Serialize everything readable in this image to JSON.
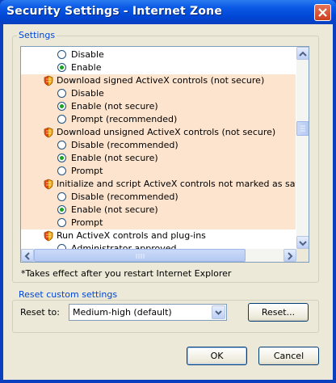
{
  "window": {
    "title": "Security Settings - Internet Zone"
  },
  "settings_group": {
    "label": "Settings"
  },
  "list": {
    "rows": [
      {
        "kind": "radio",
        "label": "Disable",
        "checked": false,
        "indent": 1,
        "hl": false
      },
      {
        "kind": "radio",
        "label": "Enable",
        "checked": true,
        "indent": 1,
        "hl": false
      },
      {
        "kind": "header",
        "label": "Download signed ActiveX controls (not secure)",
        "hl": true
      },
      {
        "kind": "radio",
        "label": "Disable",
        "checked": false,
        "indent": 1,
        "hl": true
      },
      {
        "kind": "radio",
        "label": "Enable (not secure)",
        "checked": true,
        "indent": 1,
        "hl": true
      },
      {
        "kind": "radio",
        "label": "Prompt (recommended)",
        "checked": false,
        "indent": 1,
        "hl": true
      },
      {
        "kind": "header",
        "label": "Download unsigned ActiveX controls (not secure)",
        "hl": true
      },
      {
        "kind": "radio",
        "label": "Disable (recommended)",
        "checked": false,
        "indent": 1,
        "hl": true
      },
      {
        "kind": "radio",
        "label": "Enable (not secure)",
        "checked": true,
        "indent": 1,
        "hl": true
      },
      {
        "kind": "radio",
        "label": "Prompt",
        "checked": false,
        "indent": 1,
        "hl": true
      },
      {
        "kind": "header",
        "label": "Initialize and script ActiveX controls not marked as safe for sc",
        "hl": true
      },
      {
        "kind": "radio",
        "label": "Disable (recommended)",
        "checked": false,
        "indent": 1,
        "hl": true
      },
      {
        "kind": "radio",
        "label": "Enable (not secure)",
        "checked": true,
        "indent": 1,
        "hl": true
      },
      {
        "kind": "radio",
        "label": "Prompt",
        "checked": false,
        "indent": 1,
        "hl": true
      },
      {
        "kind": "header",
        "label": "Run ActiveX controls and plug-ins",
        "hl": false
      },
      {
        "kind": "radio",
        "label": "Administrator approved",
        "checked": false,
        "indent": 1,
        "hl": false
      }
    ],
    "vertical_scroll_position": 0.38
  },
  "note": "*Takes effect after you restart Internet Explorer",
  "reset_group": {
    "label": "Reset custom settings",
    "reset_to_label": "Reset to:",
    "selected": "Medium-high (default)",
    "reset_button": "Reset..."
  },
  "buttons": {
    "ok": "OK",
    "cancel": "Cancel"
  },
  "colors": {
    "highlight": "#fde4cf",
    "title_bar": "#0046d5",
    "radio_dot": "#21a121",
    "group_label": "#0046d5"
  }
}
